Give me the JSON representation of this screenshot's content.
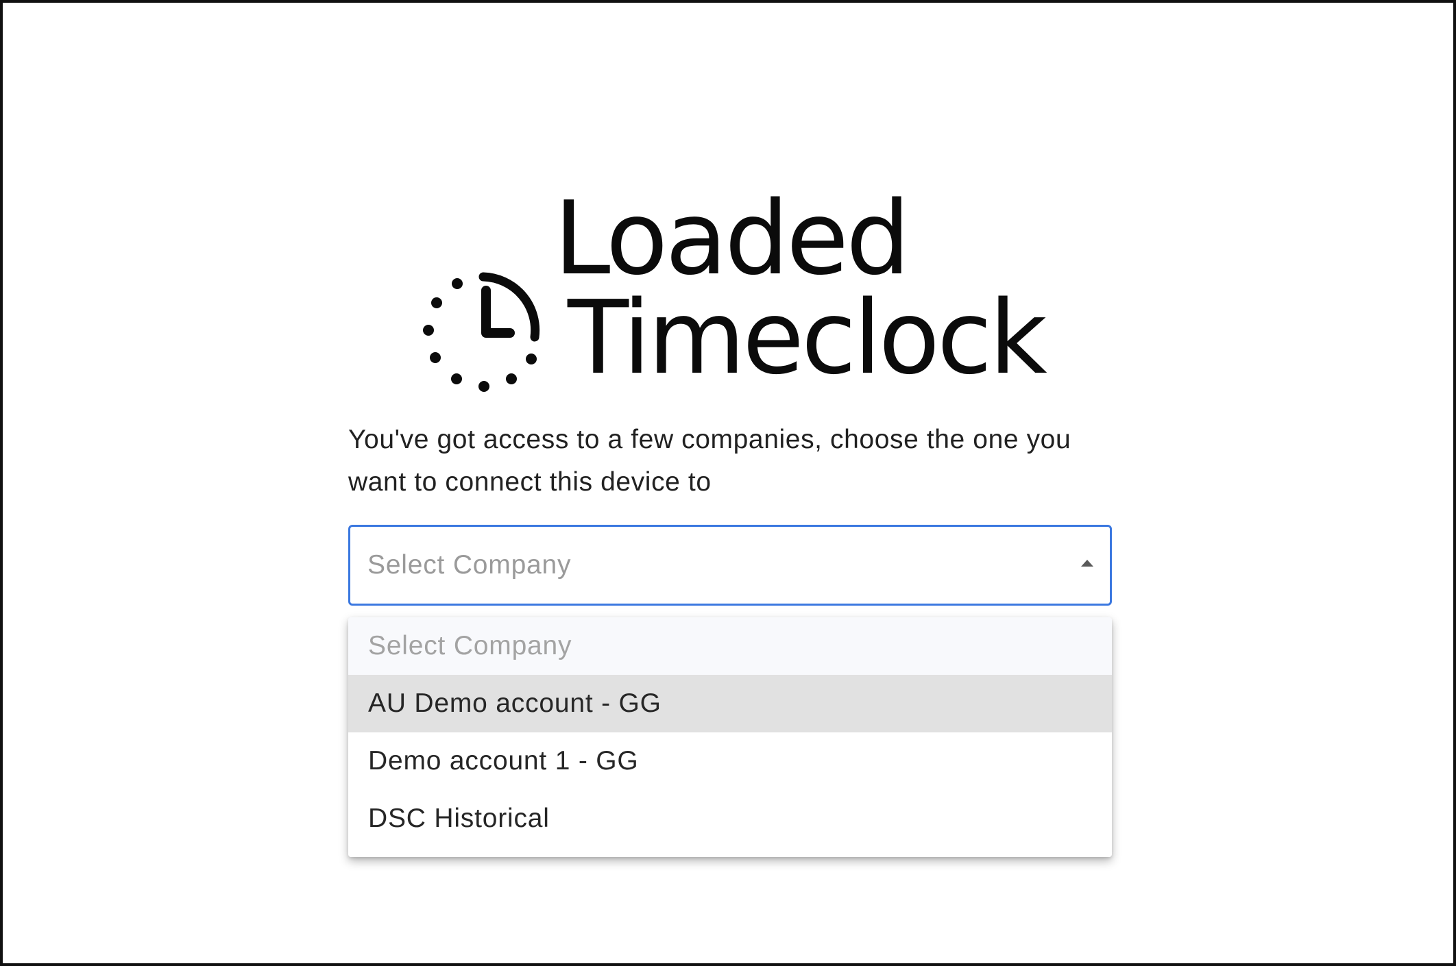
{
  "brand": {
    "logo_line1": "Loaded",
    "logo_line2": "Timeclock"
  },
  "prompt": {
    "text": "You've got access to a few companies, choose the one you want to connect this device to"
  },
  "company_select": {
    "placeholder": "Select Company",
    "state": "open",
    "caret_icon": "caret-up-icon",
    "focus_color": "#3b78e0",
    "options": [
      {
        "label": "Select Company",
        "is_placeholder": true
      },
      {
        "label": "AU Demo account - GG",
        "highlighted": true
      },
      {
        "label": "Demo account 1 - GG"
      },
      {
        "label": "DSC Historical"
      }
    ]
  }
}
